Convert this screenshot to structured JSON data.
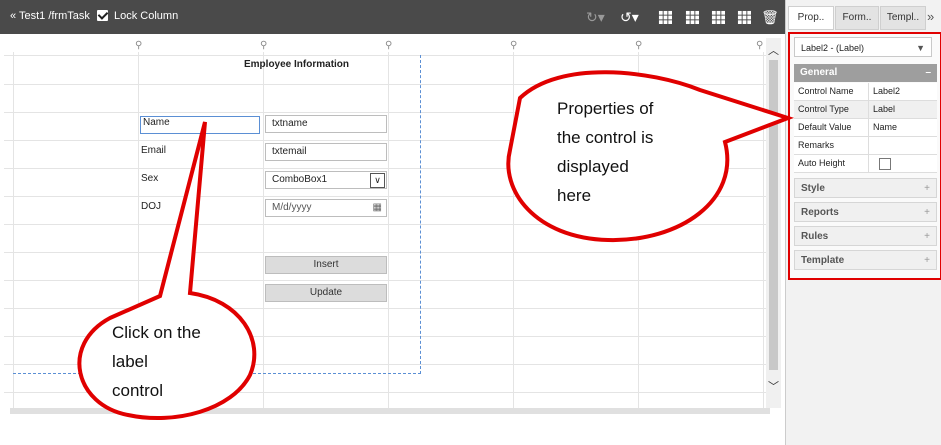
{
  "toolbar": {
    "breadcrumb": "«  Test1 /frmTask",
    "lock_label": "Lock Column"
  },
  "tabs": [
    {
      "label": "Prop.."
    },
    {
      "label": "Form.."
    },
    {
      "label": "Templ.."
    }
  ],
  "tabs_more": "»",
  "properties": {
    "selected_control": "Label2 - (Label)",
    "section_title": "General",
    "rows": [
      {
        "key": "Control Name",
        "value": "Label2"
      },
      {
        "key": "Control Type",
        "value": "Label"
      },
      {
        "key": "Default Value",
        "value": "Name"
      },
      {
        "key": "Remarks",
        "value": ""
      },
      {
        "key": "Auto Height",
        "value": ""
      }
    ],
    "collapsed_sections": [
      "Style",
      "Reports",
      "Rules",
      "Template"
    ],
    "collapse_symbol": "–",
    "expand_symbol": "+"
  },
  "form": {
    "heading": "Employee Information",
    "labels": [
      "Name",
      "Email",
      "Sex",
      "DOJ"
    ],
    "inputs": {
      "name": "txtname",
      "email": "txtemail",
      "sex": "ComboBox1",
      "doj_placeholder": "M/d/yyyy"
    },
    "buttons": {
      "insert": "Insert",
      "update": "Update"
    }
  },
  "callouts": {
    "properties_text": [
      "Properties of",
      "the control is",
      "displayed",
      "here"
    ],
    "click_text": [
      "Click on the",
      "label",
      "control"
    ]
  },
  "colors": {
    "callout_border": "#e00000",
    "toolbar_bg": "#4a4a4a",
    "section_header": "#9e9e9e"
  }
}
